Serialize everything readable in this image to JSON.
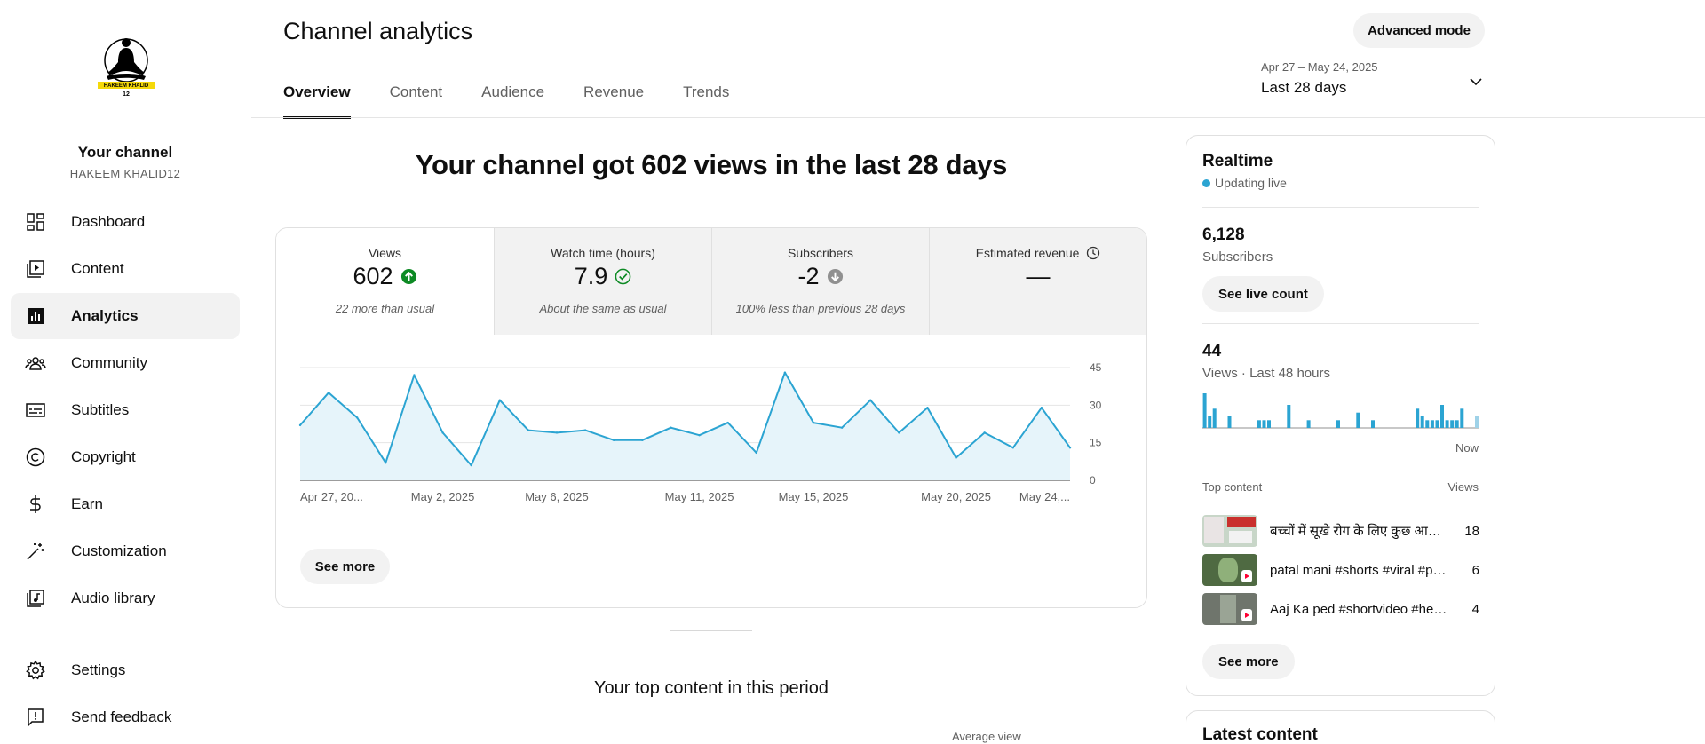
{
  "sidebar": {
    "avatar_logo_text": "HAKEEM KHALID",
    "avatar_logo_num": "12",
    "channel_title": "Your channel",
    "channel_handle": "HAKEEM KHALID12",
    "items": [
      {
        "label": "Dashboard",
        "icon": "dashboard-icon"
      },
      {
        "label": "Content",
        "icon": "content-icon"
      },
      {
        "label": "Analytics",
        "icon": "analytics-icon",
        "active": true
      },
      {
        "label": "Community",
        "icon": "community-icon"
      },
      {
        "label": "Subtitles",
        "icon": "subtitles-icon"
      },
      {
        "label": "Copyright",
        "icon": "copyright-icon"
      },
      {
        "label": "Earn",
        "icon": "dollar-icon"
      },
      {
        "label": "Customization",
        "icon": "magic-wand-icon"
      },
      {
        "label": "Audio library",
        "icon": "audio-library-icon"
      }
    ],
    "bottom_items": [
      {
        "label": "Settings",
        "icon": "gear-icon"
      },
      {
        "label": "Send feedback",
        "icon": "feedback-icon"
      }
    ]
  },
  "header": {
    "title": "Channel analytics",
    "advanced_button": "Advanced mode",
    "tabs": [
      "Overview",
      "Content",
      "Audience",
      "Revenue",
      "Trends"
    ],
    "active_tab": "Overview",
    "date_range_small": "Apr 27 – May 24, 2025",
    "date_range_label": "Last 28 days"
  },
  "main": {
    "headline": "Your channel got 602 views in the last 28 days",
    "metrics": [
      {
        "label": "Views",
        "value": "602",
        "note": "22 more than usual",
        "status": "up",
        "status_color": "#0d8a24"
      },
      {
        "label": "Watch time (hours)",
        "value": "7.9",
        "note": "About the same as usual",
        "status": "check",
        "status_color": "#0d8a24"
      },
      {
        "label": "Subscribers",
        "value": "-2",
        "note": "100% less than previous 28 days",
        "status": "down",
        "status_color": "#909090"
      },
      {
        "label": "Estimated revenue",
        "value": "—",
        "note": "",
        "status": "clock",
        "status_color": "#606060"
      }
    ],
    "see_more": "See more",
    "top_content_title": "Your top content in this period",
    "avg_view_label": "Average view"
  },
  "chart_data": {
    "type": "area",
    "series": [
      {
        "values": [
          22,
          35,
          25,
          7,
          42,
          19,
          6,
          32,
          20,
          19,
          20,
          16,
          16,
          21,
          18,
          23,
          11,
          43,
          23,
          21,
          32,
          19,
          29,
          9,
          19,
          13,
          29,
          13
        ]
      }
    ],
    "x_tick_labels": [
      "Apr 27, 20...",
      "May 2, 2025",
      "May 6, 2025",
      "May 11, 2025",
      "May 15, 2025",
      "May 20, 2025",
      "May 24,..."
    ],
    "x_tick_days": [
      0,
      5,
      9,
      14,
      18,
      23,
      27
    ],
    "y_ticks": [
      45,
      30,
      15,
      0
    ],
    "ylim": [
      0,
      45
    ],
    "line_color": "#2ba4d2",
    "fill_color": "#e6f4fa",
    "grid": true
  },
  "realtime": {
    "title": "Realtime",
    "live_label": "Updating live",
    "subscribers_value": "6,128",
    "subscribers_label": "Subscribers",
    "live_count_button": "See live count",
    "views_value": "44",
    "views_label": "Views · Last 48 hours",
    "now_label": "Now",
    "bars": [
      9,
      3,
      5,
      0,
      0,
      3,
      0,
      0,
      0,
      0,
      0,
      2,
      2,
      2,
      0,
      0,
      0,
      6,
      0,
      0,
      0,
      2,
      0,
      0,
      0,
      0,
      0,
      2,
      0,
      0,
      0,
      4,
      0,
      0,
      2,
      0,
      0,
      0,
      0,
      0,
      0,
      0,
      0,
      5,
      3,
      2,
      2,
      2,
      6,
      2,
      2,
      2,
      5,
      0,
      0,
      3
    ],
    "bar_color": "#2ba4d2",
    "top_content_label": "Top content",
    "top_views_label": "Views",
    "top_content": [
      {
        "title": "बच्चों में सूखे रोग के लिए कुछ आसान उपाय",
        "views": "18"
      },
      {
        "title": "patal mani #shorts #viral #patalmani",
        "views": "6"
      },
      {
        "title": "Aaj Ka ped #shortvideo #healthtips",
        "views": "4"
      }
    ],
    "see_more": "See more"
  },
  "latest": {
    "title": "Latest content"
  }
}
